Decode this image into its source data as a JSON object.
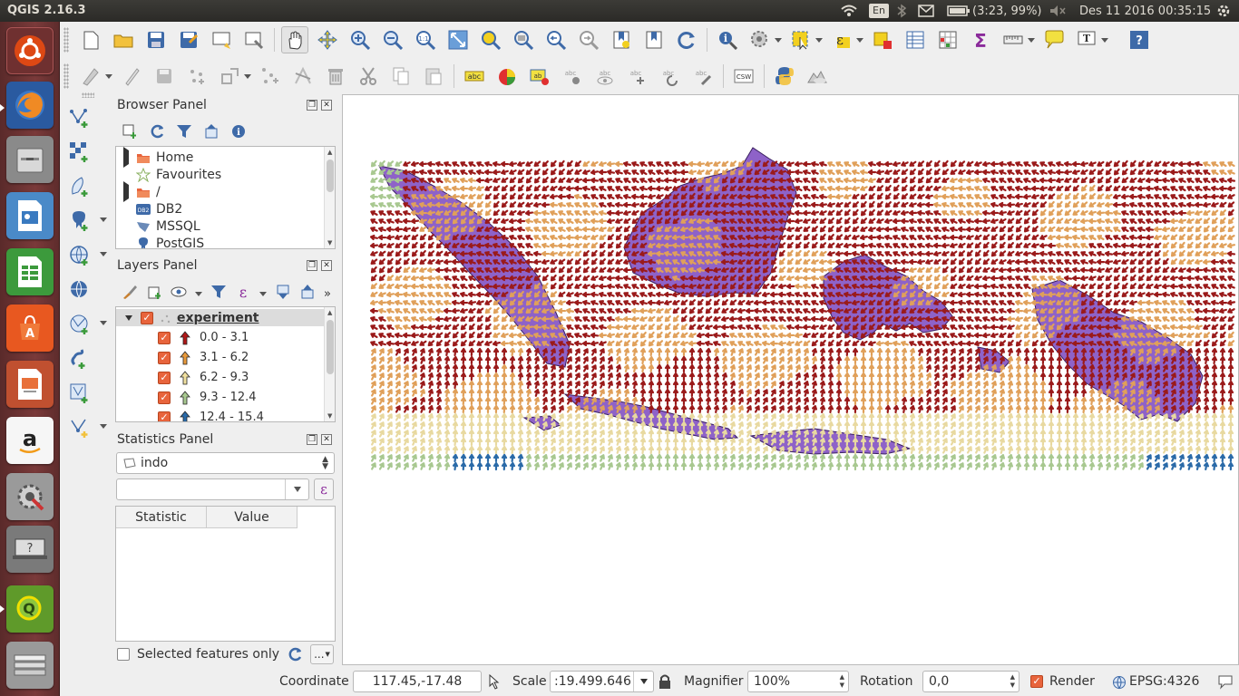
{
  "topbar": {
    "app_title": "QGIS 2.16.3",
    "language": "En",
    "battery": "(3:23, 99%)",
    "clock": "Des 11 2016 00:35:15",
    "icons": [
      "wifi-icon",
      "bluetooth-icon",
      "mail-icon",
      "battery-icon",
      "volume-muted-icon",
      "power-gear-icon"
    ]
  },
  "launcher": {
    "items": [
      "ubuntu-dash",
      "firefox",
      "files",
      "libreoffice-draw",
      "libreoffice-calc",
      "software-center",
      "libreoffice-impress",
      "amazon",
      "system-settings",
      "help-device",
      "qgis",
      "trash-stack"
    ]
  },
  "browser_panel": {
    "title": "Browser Panel",
    "items": [
      {
        "label": "Home",
        "expandable": true,
        "icon": "folder-icon"
      },
      {
        "label": "Favourites",
        "expandable": false,
        "icon": "star-icon"
      },
      {
        "label": "/",
        "expandable": true,
        "icon": "folder-icon"
      },
      {
        "label": "DB2",
        "expandable": false,
        "icon": "db2-icon"
      },
      {
        "label": "MSSQL",
        "expandable": false,
        "icon": "mssql-icon"
      },
      {
        "label": "PostGIS",
        "expandable": false,
        "icon": "postgis-elephant-icon"
      }
    ]
  },
  "layers_panel": {
    "title": "Layers Panel",
    "layer_name": "experiment",
    "classes": [
      {
        "label": "0.0 - 3.1",
        "color": "#b01818"
      },
      {
        "label": "3.1 - 6.2",
        "color": "#e89a3c"
      },
      {
        "label": "6.2 - 9.3",
        "color": "#f0e0a0"
      },
      {
        "label": "9.3 - 12.4",
        "color": "#a8c890"
      },
      {
        "label": "12.4 - 15.4",
        "color": "#2a6aa8"
      }
    ]
  },
  "statistics_panel": {
    "title": "Statistics Panel",
    "layer": "indo",
    "field_value": "",
    "headers": [
      "Statistic",
      "Value"
    ],
    "selected_only_label": "Selected features only",
    "more_label": "..."
  },
  "statusbar": {
    "coordinate_label": "Coordinate",
    "coordinate_value": "117.45,-17.48",
    "scale_label": "Scale",
    "scale_value": ":19.499.646",
    "magnifier_label": "Magnifier",
    "magnifier_value": "100%",
    "rotation_label": "Rotation",
    "rotation_value": "0,0",
    "render_label": "Render",
    "crs_label": "EPSG:4326"
  },
  "colors": {
    "land": "#8e62c8",
    "arrow_dark_red": "#9a1a1a",
    "arrow_orange": "#e0a05a",
    "arrow_light": "#e8d9a0",
    "arrow_green": "#a8c890",
    "arrow_blue": "#2a6aa8"
  }
}
